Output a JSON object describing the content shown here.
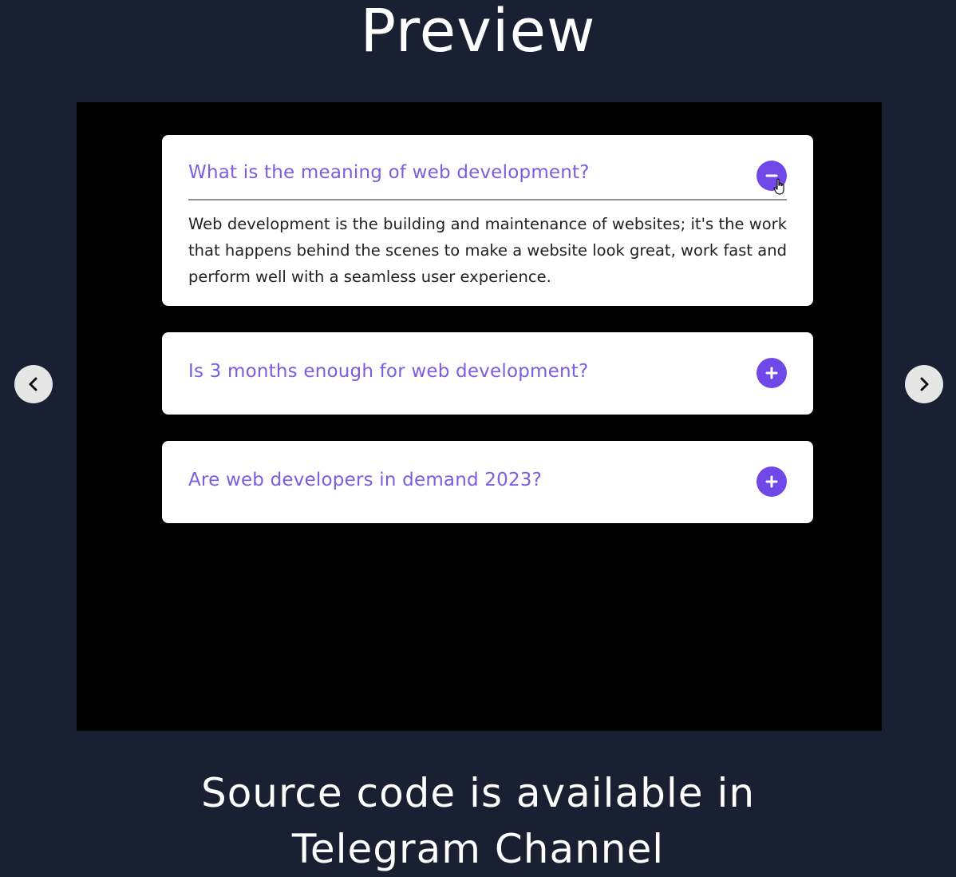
{
  "page": {
    "title": "Preview",
    "footer_line1": "Source code is available in",
    "footer_line2": "Telegram Channel"
  },
  "colors": {
    "background": "#192032",
    "accent": "#7048e8",
    "question_text": "#7c5ce0"
  },
  "navigation": {
    "prev_icon": "chevron-left-icon",
    "next_icon": "chevron-right-icon"
  },
  "faq": {
    "items": [
      {
        "question": "What is the meaning of web development?",
        "answer": "Web development is the building and maintenance of websites; it's the work that happens behind the scenes to make a website look great, work fast and perform well with a seamless user experience.",
        "expanded": true,
        "icon": "minus-icon"
      },
      {
        "question": "Is 3 months enough for web development?",
        "expanded": false,
        "icon": "plus-icon"
      },
      {
        "question": "Are web developers in demand 2023?",
        "expanded": false,
        "icon": "plus-icon"
      }
    ]
  }
}
